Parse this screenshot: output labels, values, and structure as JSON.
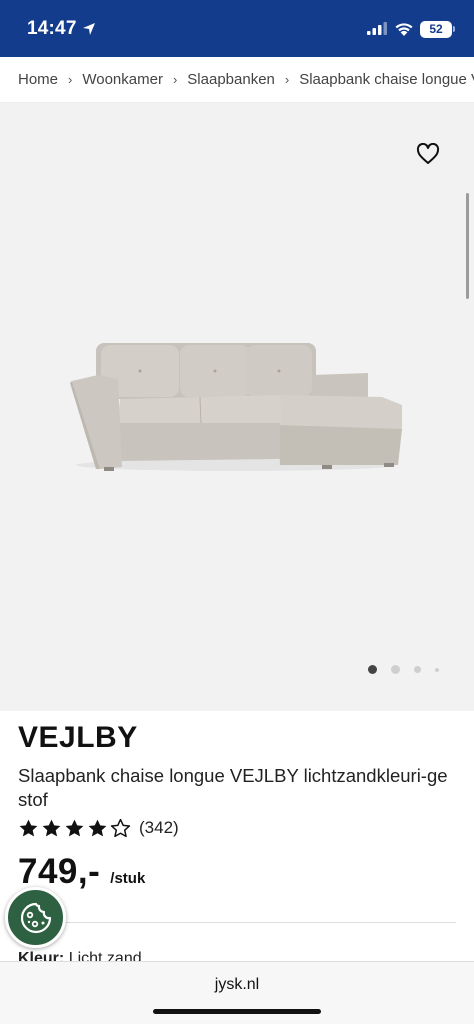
{
  "status_bar": {
    "time": "14:47",
    "battery": "52"
  },
  "breadcrumb": [
    "Home",
    "Woonkamer",
    "Slaapbanken",
    "Slaapbank chaise longue VEJLBY"
  ],
  "icons": {
    "location": "location-arrow-icon",
    "signal": "cellular-signal-icon",
    "wifi": "wifi-icon",
    "favorite": "heart-outline-icon",
    "cookie": "cookie-icon",
    "star": "star-icon"
  },
  "gallery": {
    "image": "sofa-product-image",
    "image_count": 4,
    "active_index": 0
  },
  "product": {
    "name": "VEJLBY",
    "description": "Slaapbank chaise longue VEJLBY lichtzandkleuri-ge stof",
    "rating": 4,
    "rating_max": 5,
    "reviews": "(342)",
    "price": "749,-",
    "price_unit": "/stuk",
    "colour_label": "Kleur:",
    "colour_value": "Licht zand"
  },
  "browser": {
    "url": "jysk.nl"
  },
  "colors": {
    "brand_blue": "#143c8c",
    "cookie_green": "#2e6142",
    "gallery_bg": "#f2f2f2"
  }
}
